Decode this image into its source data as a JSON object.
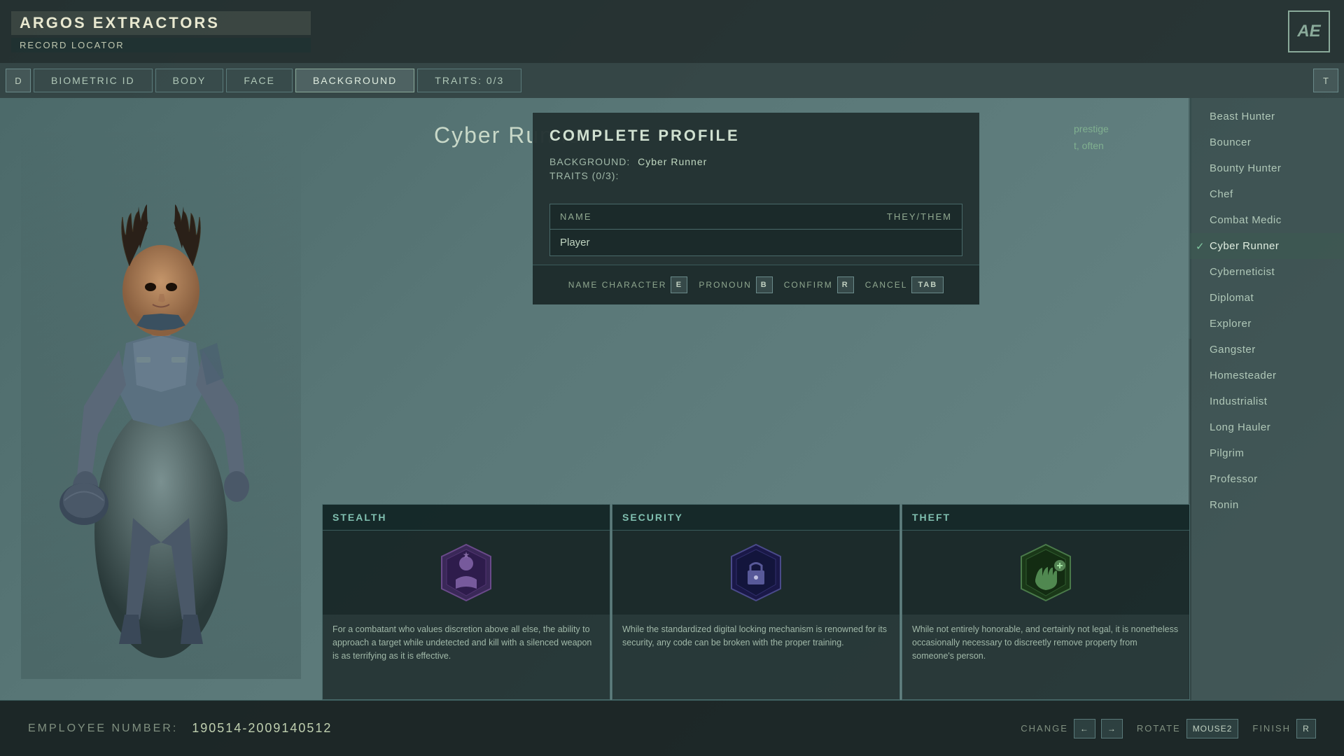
{
  "app": {
    "company": "ARGOS EXTRACTORS",
    "record_locator": "RECORD LOCATOR",
    "ae_logo": "AE"
  },
  "nav": {
    "back_btn": "D",
    "forward_btn": "T",
    "tabs": [
      {
        "label": "BIOMETRIC ID",
        "active": false
      },
      {
        "label": "BODY",
        "active": false
      },
      {
        "label": "FACE",
        "active": false
      },
      {
        "label": "BACKGROUND",
        "active": true
      },
      {
        "label": "TRAITS: 0/3",
        "active": false
      }
    ]
  },
  "background": {
    "title": "Cyber Runner",
    "description_prestige": "prestige",
    "description_often": "t, often"
  },
  "modal": {
    "title": "COMPLETE PROFILE",
    "background_label": "BACKGROUND:",
    "background_value": "Cyber Runner",
    "traits_label": "TRAITS (0/3):",
    "table_headers": {
      "name": "NAME",
      "pronoun": "THEY/THEM"
    },
    "player_name": "Player",
    "actions": [
      {
        "label": "NAME CHARACTER",
        "key": "E"
      },
      {
        "label": "PRONOUN",
        "key": "B"
      },
      {
        "label": "CONFIRM",
        "key": "R"
      },
      {
        "label": "CANCEL",
        "key": "TAB"
      }
    ]
  },
  "skill_cards": [
    {
      "id": "stealth",
      "header": "STEALTH",
      "description": "For a combatant who values discretion above all else, the ability to approach a target while undetected and kill with a silenced weapon is as terrifying as it is effective.",
      "icon_color": "#6a4a8a"
    },
    {
      "id": "security",
      "header": "SECURITY",
      "description": "While the standardized digital locking mechanism is renowned for its security, any code can be broken with the proper training.",
      "icon_color": "#4a4a8a"
    },
    {
      "id": "theft",
      "header": "THEFT",
      "description": "While not entirely honorable, and certainly not legal, it is nonetheless occasionally necessary to discreetly remove property from someone's person.",
      "icon_color": "#4a7a4a"
    }
  ],
  "sidebar": {
    "items": [
      {
        "label": "Beast Hunter",
        "selected": false
      },
      {
        "label": "Bouncer",
        "selected": false
      },
      {
        "label": "Bounty Hunter",
        "selected": false
      },
      {
        "label": "Chef",
        "selected": false
      },
      {
        "label": "Combat Medic",
        "selected": false
      },
      {
        "label": "Cyber Runner",
        "selected": true
      },
      {
        "label": "Cyberneticist",
        "selected": false
      },
      {
        "label": "Diplomat",
        "selected": false
      },
      {
        "label": "Explorer",
        "selected": false
      },
      {
        "label": "Gangster",
        "selected": false
      },
      {
        "label": "Homesteader",
        "selected": false
      },
      {
        "label": "Industrialist",
        "selected": false
      },
      {
        "label": "Long Hauler",
        "selected": false
      },
      {
        "label": "Pilgrim",
        "selected": false
      },
      {
        "label": "Professor",
        "selected": false
      },
      {
        "label": "Ronin",
        "selected": false
      }
    ]
  },
  "bottom_bar": {
    "employee_label": "EMPLOYEE NUMBER:",
    "employee_number": "190514-2009140512",
    "actions": [
      {
        "label": "CHANGE",
        "keys": [
          "←",
          "→"
        ]
      },
      {
        "label": "ROTATE",
        "keys": [
          "MOUSE2"
        ]
      },
      {
        "label": "FINISH",
        "keys": [
          "R"
        ]
      }
    ]
  }
}
